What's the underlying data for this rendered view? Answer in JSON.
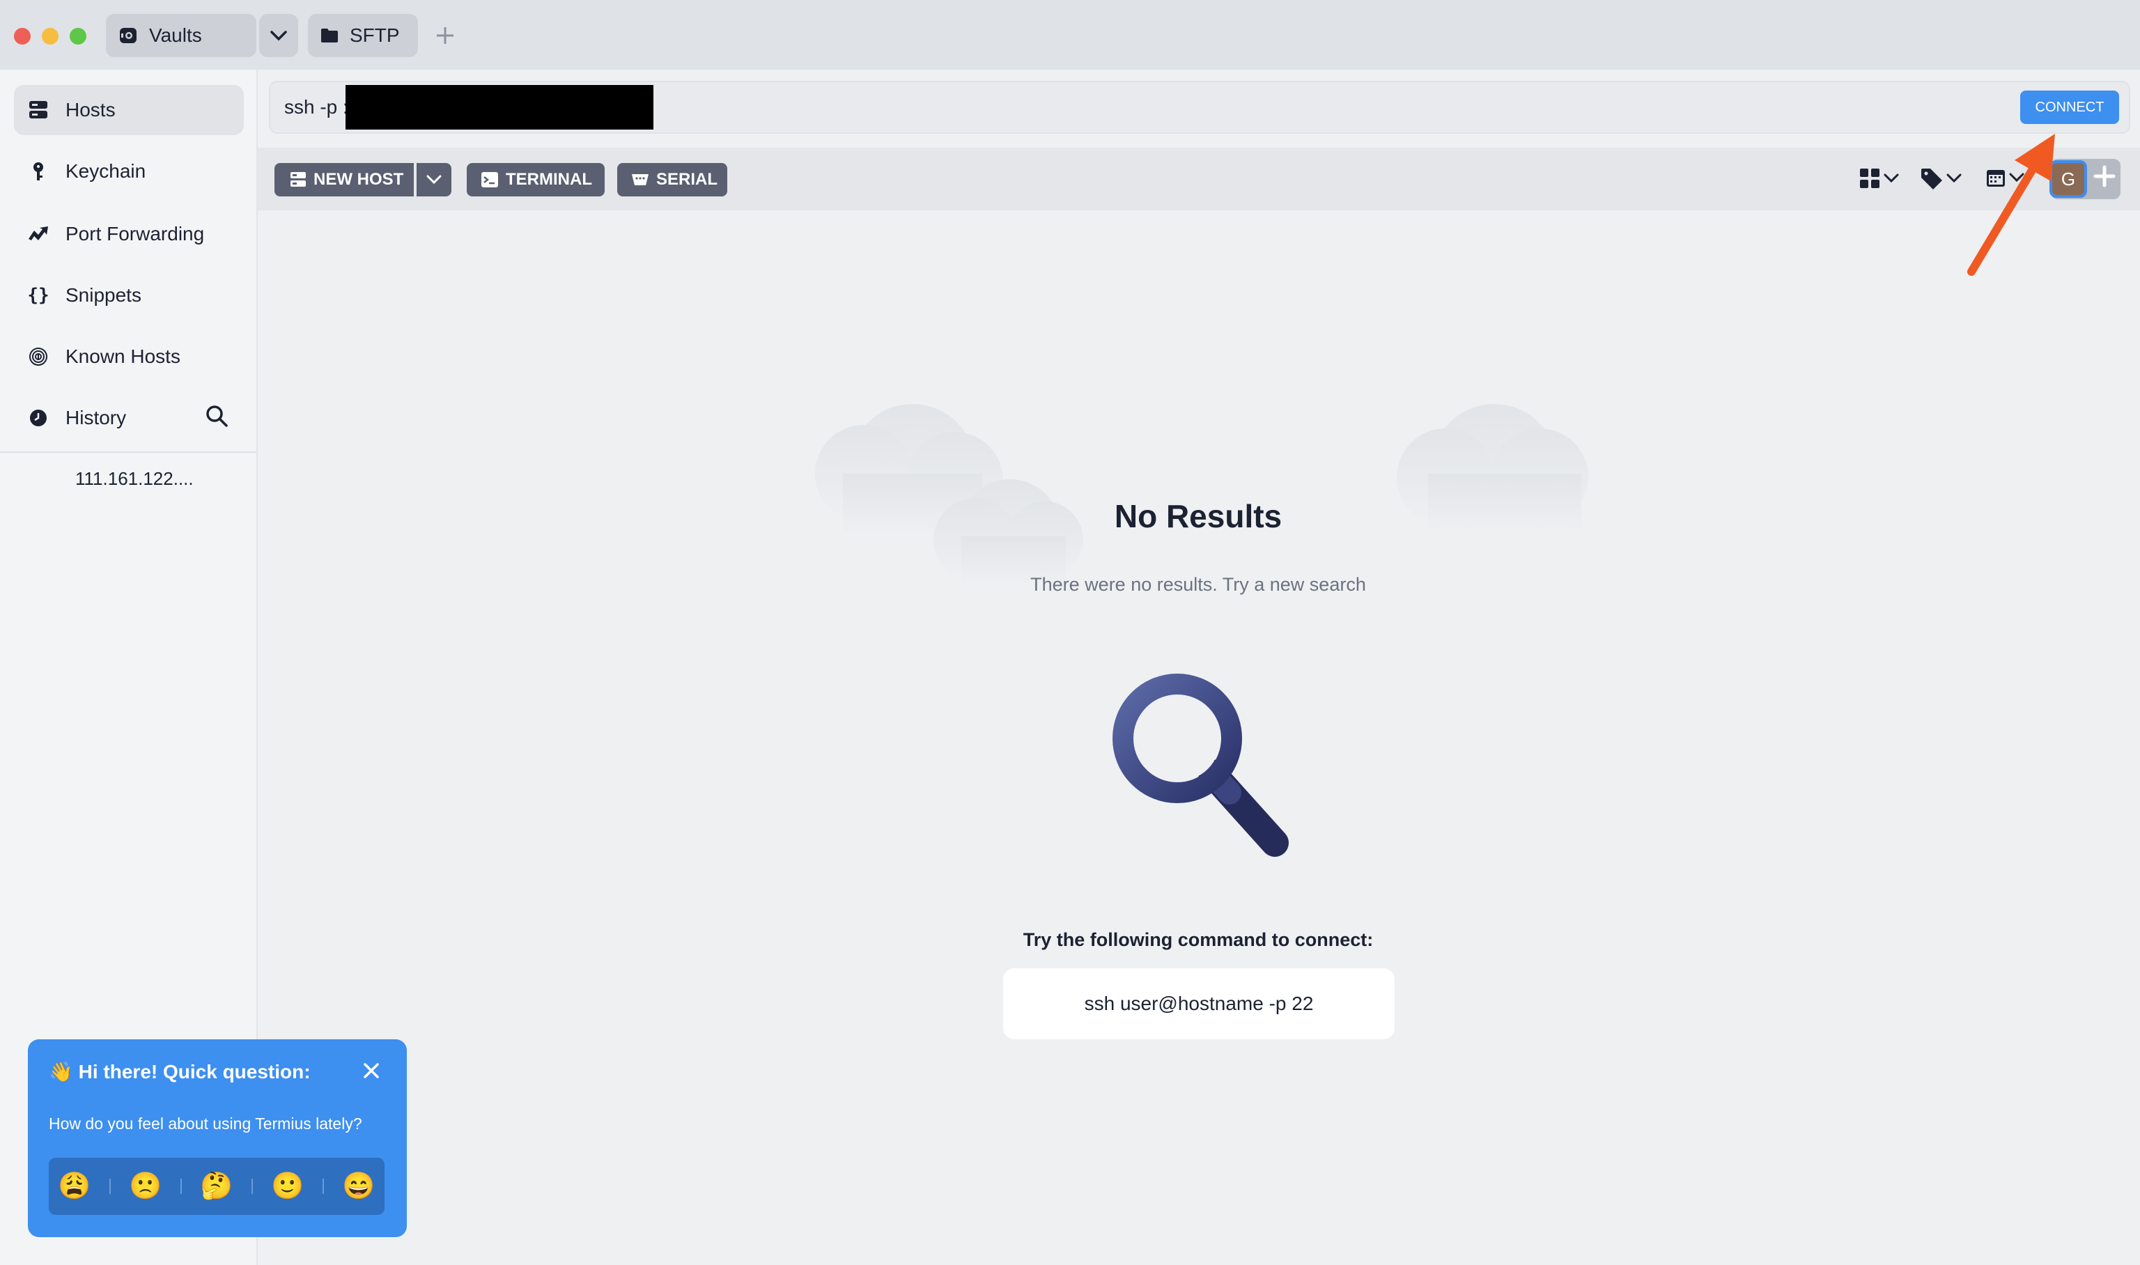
{
  "window": {
    "tabs": [
      {
        "label": "Vaults",
        "icon": "vault-icon"
      },
      {
        "label": "SFTP",
        "icon": "folder-icon"
      }
    ],
    "new_tab_icon": "plus-icon"
  },
  "sidebar": {
    "items": [
      {
        "label": "Hosts",
        "icon": "server-icon",
        "active": true
      },
      {
        "label": "Keychain",
        "icon": "key-icon"
      },
      {
        "label": "Port Forwarding",
        "icon": "forward-icon"
      },
      {
        "label": "Snippets",
        "icon": "braces-icon"
      },
      {
        "label": "Known Hosts",
        "icon": "fingerprint-icon"
      },
      {
        "label": "History",
        "icon": "clock-icon"
      }
    ],
    "history_entry": "111.161.122....",
    "history_search_icon": "search-icon"
  },
  "command_bar": {
    "value": "ssh -p :",
    "connect_label": "CONNECT"
  },
  "toolbar": {
    "new_host_label": "NEW HOST",
    "terminal_label": "TERMINAL",
    "serial_label": "SERIAL",
    "avatar_letter": "G"
  },
  "empty_state": {
    "title": "No Results",
    "subtitle": "There were no results. Try a new search",
    "prompt": "Try the following command to connect:",
    "example_command": "ssh user@hostname -p 22"
  },
  "survey": {
    "title": "👋 Hi there! Quick question:",
    "question": "How do you feel about using Termius lately?",
    "emojis": [
      "😩",
      "🙁",
      "🤔",
      "🙂",
      "😄"
    ]
  },
  "colors": {
    "accent": "#3d8ff0",
    "annotation_arrow": "#f05a22",
    "toolbar_button": "#5a6071"
  }
}
